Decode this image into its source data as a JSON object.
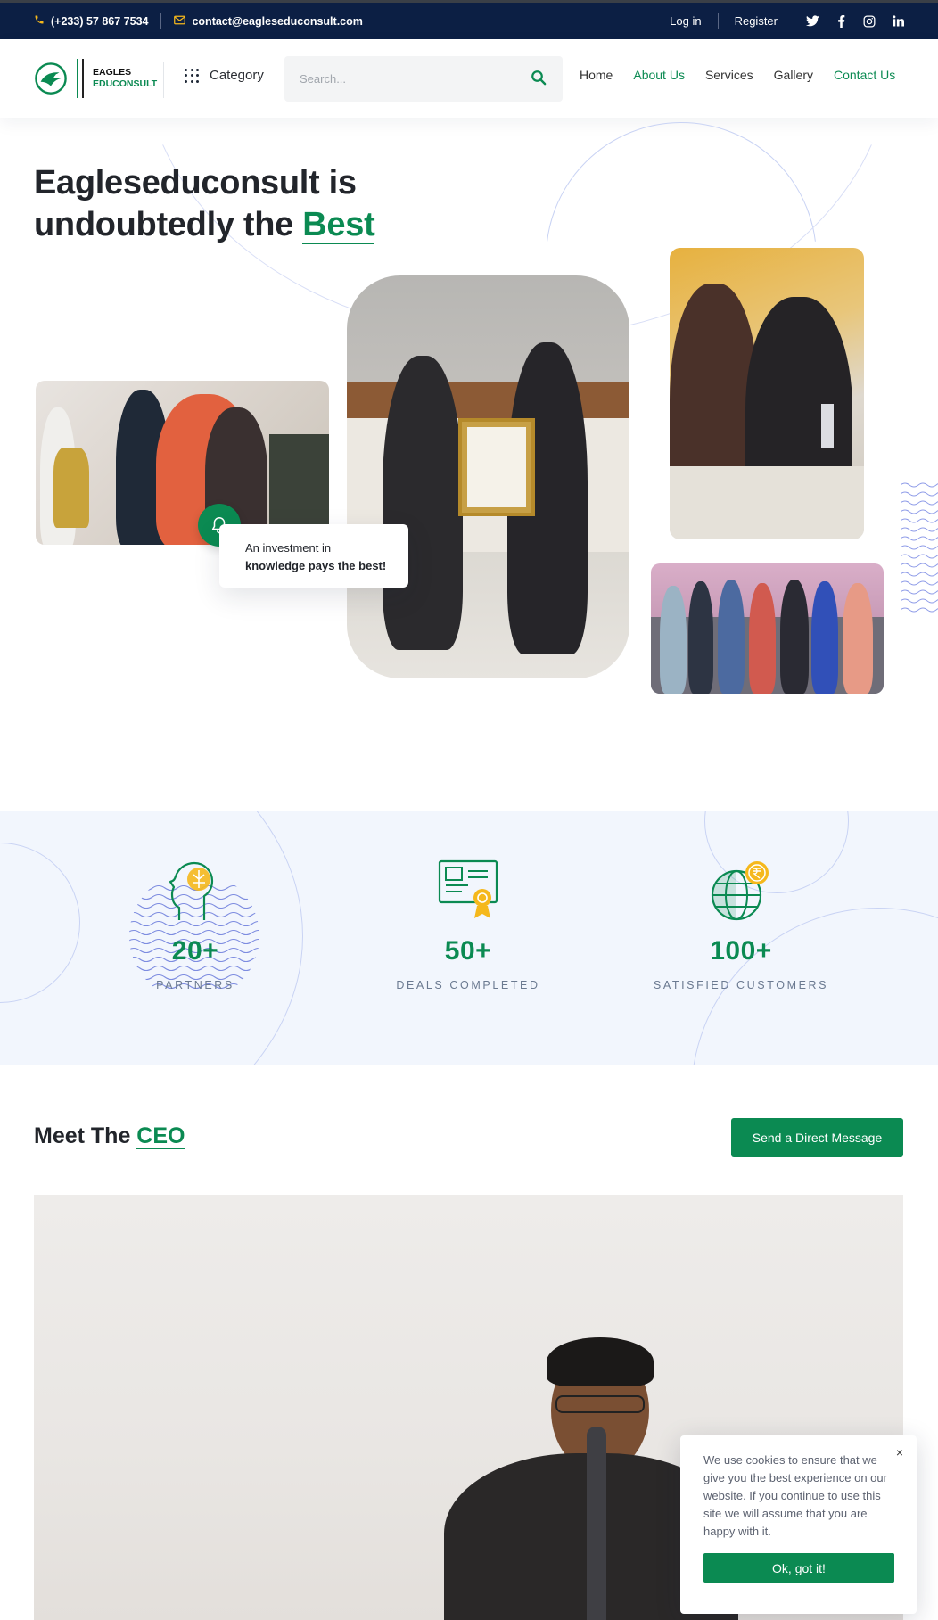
{
  "topbar": {
    "phone": "(+233) 57 867 7534",
    "email": "contact@eagleseduconsult.com",
    "login": "Log in",
    "register": "Register",
    "social": [
      "twitter-icon",
      "facebook-icon",
      "instagram-icon",
      "linkedin-icon"
    ]
  },
  "header": {
    "logo_line1": "EAGLES",
    "logo_line2": "EDUCONSULT",
    "category": "Category",
    "search_placeholder": "Search...",
    "nav": [
      "Home",
      "About Us",
      "Services",
      "Gallery",
      "Contact Us"
    ],
    "active_nav": [
      "About Us",
      "Contact Us"
    ]
  },
  "hero": {
    "title_line1": "Eagleseduconsult is",
    "title_line2": "undoubtedly the ",
    "title_accent": "Best",
    "note_line1": "An investment in",
    "note_line2": "knowledge pays the best!"
  },
  "stats": [
    {
      "number": "20+",
      "label": "PARTNERS",
      "icon": "head-circuit-icon"
    },
    {
      "number": "50+",
      "label": "DEALS COMPLETED",
      "icon": "certificate-icon"
    },
    {
      "number": "100+",
      "label": "SATISFIED CUSTOMERS",
      "icon": "globe-coin-icon"
    }
  ],
  "ceo": {
    "title": "Meet The ",
    "title_accent": "CEO",
    "button": "Send a Direct Message"
  },
  "cookie": {
    "text": "We use cookies to ensure that we give you the best experience on our website. If you continue to use this site we will assume that you are happy with it.",
    "button": "Ok, got it!",
    "close": "×"
  },
  "colors": {
    "brand_green": "#0b8a52",
    "topbar_navy": "#0c1f44",
    "accent_yellow": "#f5b81c",
    "stats_bg": "#f2f6fd"
  }
}
